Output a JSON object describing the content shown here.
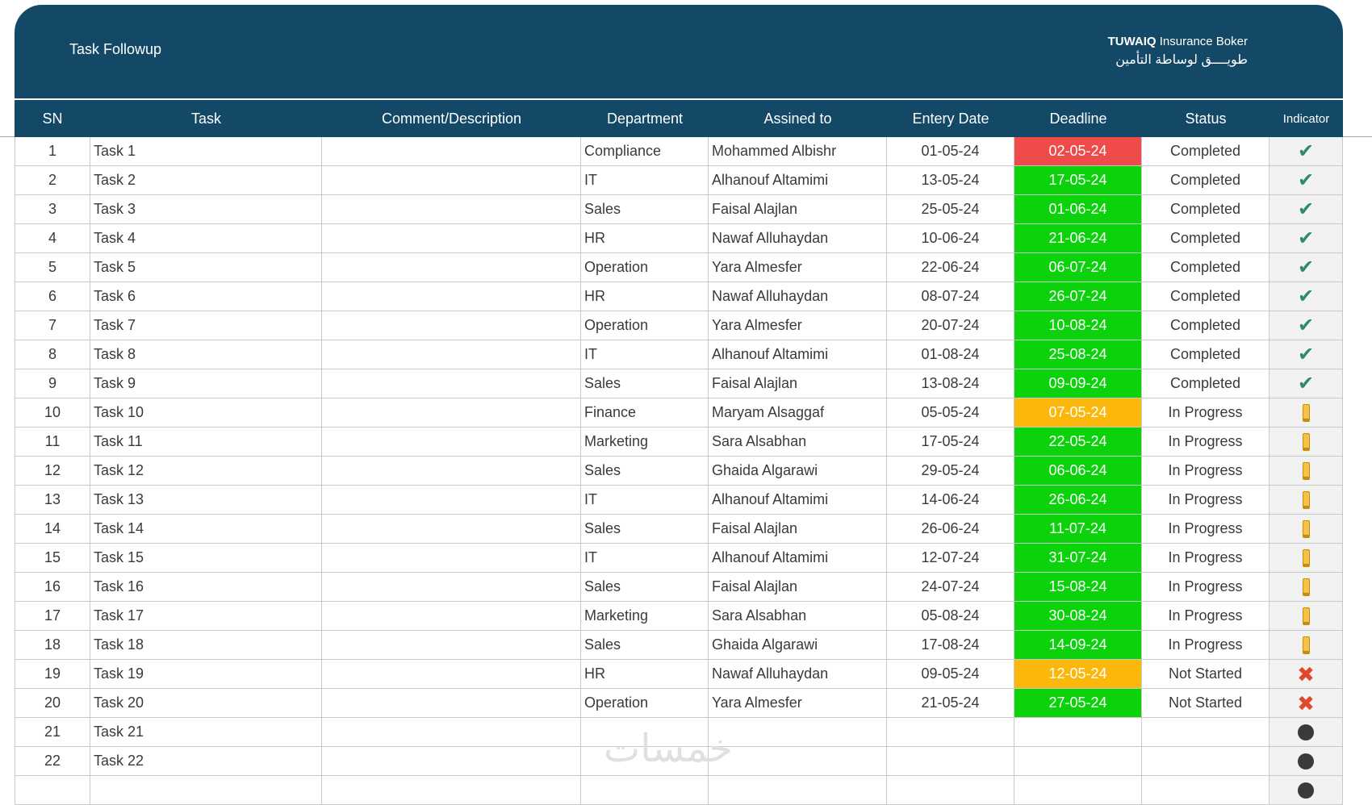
{
  "header": {
    "title": "Task Followup",
    "brand_bold": "TUWAIQ",
    "brand_rest": " Insurance Boker",
    "brand_arabic": "طويــــق لوساطة التأمين"
  },
  "columns": {
    "sn": "SN",
    "task": "Task",
    "comment": "Comment/Description",
    "department": "Department",
    "assigned": "Assined to",
    "entry": "Entery Date",
    "deadline": "Deadline",
    "status": "Status",
    "indicator": "Indicator"
  },
  "colors": {
    "header_bg": "#134866",
    "deadline_red": "#f04b4b",
    "deadline_green": "#0bd20b",
    "deadline_orange": "#fbb70c"
  },
  "rows": [
    {
      "sn": "1",
      "task": "Task 1",
      "comment": "",
      "department": "Compliance",
      "assigned": "Mohammed Albishr",
      "entry": "01-05-24",
      "deadline": "02-05-24",
      "deadline_color": "#f04b4b",
      "status": "Completed",
      "indicator": "check-icon"
    },
    {
      "sn": "2",
      "task": "Task 2",
      "comment": "",
      "department": "IT",
      "assigned": "Alhanouf Altamimi",
      "entry": "13-05-24",
      "deadline": "17-05-24",
      "deadline_color": "#0bd20b",
      "status": "Completed",
      "indicator": "check-icon"
    },
    {
      "sn": "3",
      "task": "Task 3",
      "comment": "",
      "department": "Sales",
      "assigned": "Faisal Alajlan",
      "entry": "25-05-24",
      "deadline": "01-06-24",
      "deadline_color": "#0bd20b",
      "status": "Completed",
      "indicator": "check-icon"
    },
    {
      "sn": "4",
      "task": "Task 4",
      "comment": "",
      "department": "HR",
      "assigned": "Nawaf Alluhaydan",
      "entry": "10-06-24",
      "deadline": "21-06-24",
      "deadline_color": "#0bd20b",
      "status": "Completed",
      "indicator": "check-icon"
    },
    {
      "sn": "5",
      "task": "Task 5",
      "comment": "",
      "department": "Operation",
      "assigned": "Yara Almesfer",
      "entry": "22-06-24",
      "deadline": "06-07-24",
      "deadline_color": "#0bd20b",
      "status": "Completed",
      "indicator": "check-icon"
    },
    {
      "sn": "6",
      "task": "Task 6",
      "comment": "",
      "department": "HR",
      "assigned": "Nawaf Alluhaydan",
      "entry": "08-07-24",
      "deadline": "26-07-24",
      "deadline_color": "#0bd20b",
      "status": "Completed",
      "indicator": "check-icon"
    },
    {
      "sn": "7",
      "task": "Task 7",
      "comment": "",
      "department": "Operation",
      "assigned": "Yara Almesfer",
      "entry": "20-07-24",
      "deadline": "10-08-24",
      "deadline_color": "#0bd20b",
      "status": "Completed",
      "indicator": "check-icon"
    },
    {
      "sn": "8",
      "task": "Task 8",
      "comment": "",
      "department": "IT",
      "assigned": "Alhanouf Altamimi",
      "entry": "01-08-24",
      "deadline": "25-08-24",
      "deadline_color": "#0bd20b",
      "status": "Completed",
      "indicator": "check-icon"
    },
    {
      "sn": "9",
      "task": "Task 9",
      "comment": "",
      "department": "Sales",
      "assigned": "Faisal Alajlan",
      "entry": "13-08-24",
      "deadline": "09-09-24",
      "deadline_color": "#0bd20b",
      "status": "Completed",
      "indicator": "check-icon"
    },
    {
      "sn": "10",
      "task": "Task 10",
      "comment": "",
      "department": "Finance",
      "assigned": "Maryam Alsaggaf",
      "entry": "05-05-24",
      "deadline": "07-05-24",
      "deadline_color": "#fbb70c",
      "status": "In Progress",
      "indicator": "exclamation-icon"
    },
    {
      "sn": "11",
      "task": "Task 11",
      "comment": "",
      "department": "Marketing",
      "assigned": "Sara Alsabhan",
      "entry": "17-05-24",
      "deadline": "22-05-24",
      "deadline_color": "#0bd20b",
      "status": "In Progress",
      "indicator": "exclamation-icon"
    },
    {
      "sn": "12",
      "task": "Task 12",
      "comment": "",
      "department": "Sales",
      "assigned": "Ghaida Algarawi",
      "entry": "29-05-24",
      "deadline": "06-06-24",
      "deadline_color": "#0bd20b",
      "status": "In Progress",
      "indicator": "exclamation-icon"
    },
    {
      "sn": "13",
      "task": "Task 13",
      "comment": "",
      "department": "IT",
      "assigned": "Alhanouf Altamimi",
      "entry": "14-06-24",
      "deadline": "26-06-24",
      "deadline_color": "#0bd20b",
      "status": "In Progress",
      "indicator": "exclamation-icon"
    },
    {
      "sn": "14",
      "task": "Task 14",
      "comment": "",
      "department": "Sales",
      "assigned": "Faisal Alajlan",
      "entry": "26-06-24",
      "deadline": "11-07-24",
      "deadline_color": "#0bd20b",
      "status": "In Progress",
      "indicator": "exclamation-icon"
    },
    {
      "sn": "15",
      "task": "Task 15",
      "comment": "",
      "department": "IT",
      "assigned": "Alhanouf Altamimi",
      "entry": "12-07-24",
      "deadline": "31-07-24",
      "deadline_color": "#0bd20b",
      "status": "In Progress",
      "indicator": "exclamation-icon"
    },
    {
      "sn": "16",
      "task": "Task 16",
      "comment": "",
      "department": "Sales",
      "assigned": "Faisal Alajlan",
      "entry": "24-07-24",
      "deadline": "15-08-24",
      "deadline_color": "#0bd20b",
      "status": "In Progress",
      "indicator": "exclamation-icon"
    },
    {
      "sn": "17",
      "task": "Task 17",
      "comment": "",
      "department": "Marketing",
      "assigned": "Sara Alsabhan",
      "entry": "05-08-24",
      "deadline": "30-08-24",
      "deadline_color": "#0bd20b",
      "status": "In Progress",
      "indicator": "exclamation-icon"
    },
    {
      "sn": "18",
      "task": "Task 18",
      "comment": "",
      "department": "Sales",
      "assigned": "Ghaida Algarawi",
      "entry": "17-08-24",
      "deadline": "14-09-24",
      "deadline_color": "#0bd20b",
      "status": "In Progress",
      "indicator": "exclamation-icon"
    },
    {
      "sn": "19",
      "task": "Task 19",
      "comment": "",
      "department": "HR",
      "assigned": "Nawaf Alluhaydan",
      "entry": "09-05-24",
      "deadline": "12-05-24",
      "deadline_color": "#fbb70c",
      "status": "Not Started",
      "indicator": "x-icon"
    },
    {
      "sn": "20",
      "task": "Task 20",
      "comment": "",
      "department": "Operation",
      "assigned": "Yara Almesfer",
      "entry": "21-05-24",
      "deadline": "27-05-24",
      "deadline_color": "#0bd20b",
      "status": "Not Started",
      "indicator": "x-icon"
    },
    {
      "sn": "21",
      "task": "Task 21",
      "comment": "",
      "department": "",
      "assigned": "",
      "entry": "",
      "deadline": "",
      "deadline_color": "",
      "status": "",
      "indicator": "dot-icon"
    },
    {
      "sn": "22",
      "task": "Task 22",
      "comment": "",
      "department": "",
      "assigned": "",
      "entry": "",
      "deadline": "",
      "deadline_color": "",
      "status": "",
      "indicator": "dot-icon"
    },
    {
      "sn": "",
      "task": "",
      "comment": "",
      "department": "",
      "assigned": "",
      "entry": "",
      "deadline": "",
      "deadline_color": "",
      "status": "",
      "indicator": "dot-icon"
    }
  ],
  "watermark": "خمسات"
}
